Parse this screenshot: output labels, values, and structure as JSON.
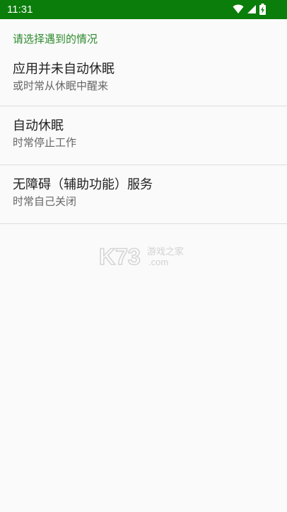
{
  "status_bar": {
    "time": "11:31",
    "background": "#0a7d0a",
    "icons": [
      "wifi-icon",
      "signal-icon",
      "battery-charging-icon"
    ]
  },
  "section_header": "请选择遇到的情况",
  "items": [
    {
      "title": "应用并未自动休眠",
      "summary": "或时常从休眠中醒来"
    },
    {
      "title": "自动休眠",
      "summary": "时常停止工作"
    },
    {
      "title": "无障碍（辅助功能）服务",
      "summary": "时常自己关闭"
    }
  ],
  "watermark": {
    "logo": "K73",
    "line1": "游戏之家",
    "line2": ".com"
  }
}
